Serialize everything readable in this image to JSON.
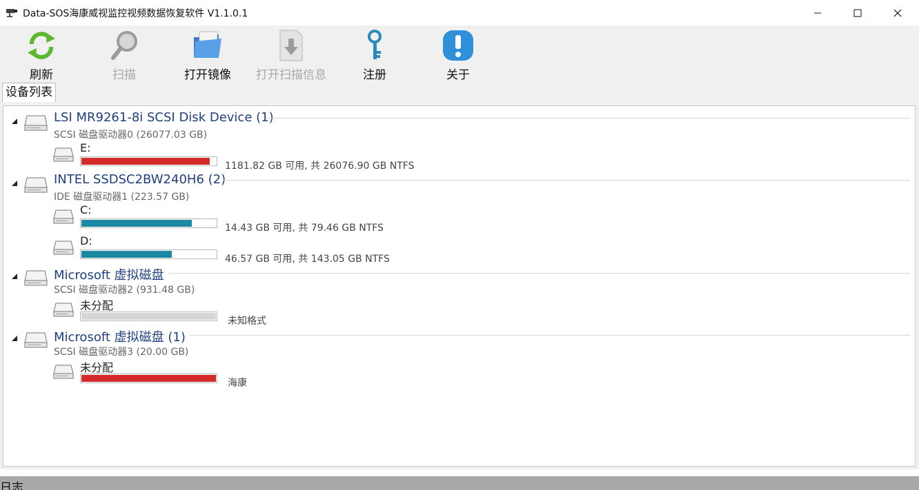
{
  "window": {
    "title": "Data-SOS海康威视监控视频数据恢复软件 V1.1.0.1"
  },
  "toolbar": [
    {
      "label": "刷新",
      "icon": "refresh-icon",
      "enabled": true
    },
    {
      "label": "扫描",
      "icon": "magnifier-icon",
      "enabled": false
    },
    {
      "label": "打开镜像",
      "icon": "folder-icon",
      "enabled": true
    },
    {
      "label": "打开扫描信息",
      "icon": "download-file-icon",
      "enabled": false
    },
    {
      "label": "注册",
      "icon": "key-icon",
      "enabled": true
    },
    {
      "label": "关于",
      "icon": "info-icon",
      "enabled": true
    }
  ],
  "tab": {
    "label": "设备列表"
  },
  "disks": [
    {
      "name": "LSI MR9261-8i SCSI Disk Device (1)",
      "sub": "SCSI 磁盘驱动器0 (26077.03 GB)",
      "volumes": [
        {
          "letter": "E:",
          "used_fraction": 0.955,
          "info": "1181.82 GB 可用, 共 26076.90 GB NTFS",
          "color": "#d42a2a"
        }
      ]
    },
    {
      "name": "INTEL SSDSC2BW240H6 (2)",
      "sub": "IDE 磁盘驱动器1 (223.57 GB)",
      "volumes": [
        {
          "letter": "C:",
          "used_fraction": 0.818,
          "info": "14.43 GB 可用, 共 79.46 GB NTFS",
          "color": "#1a87a3"
        },
        {
          "letter": "D:",
          "used_fraction": 0.674,
          "info": "46.57 GB 可用, 共 143.05 GB NTFS",
          "color": "#1a87a3"
        }
      ]
    },
    {
      "name": "Microsoft 虚拟磁盘",
      "sub": "SCSI 磁盘驱动器2 (931.48 GB)",
      "volumes": [
        {
          "letter": "未分配",
          "used_fraction": 1.0,
          "info": "未知格式",
          "color": "#d6d6d6"
        }
      ]
    },
    {
      "name": "Microsoft 虚拟磁盘 (1)",
      "sub": "SCSI 磁盘驱动器3 (20.00 GB)",
      "volumes": [
        {
          "letter": "未分配",
          "used_fraction": 1.0,
          "info": "海康",
          "color": "#d42a2a"
        }
      ]
    }
  ],
  "log": {
    "label": "日志"
  }
}
